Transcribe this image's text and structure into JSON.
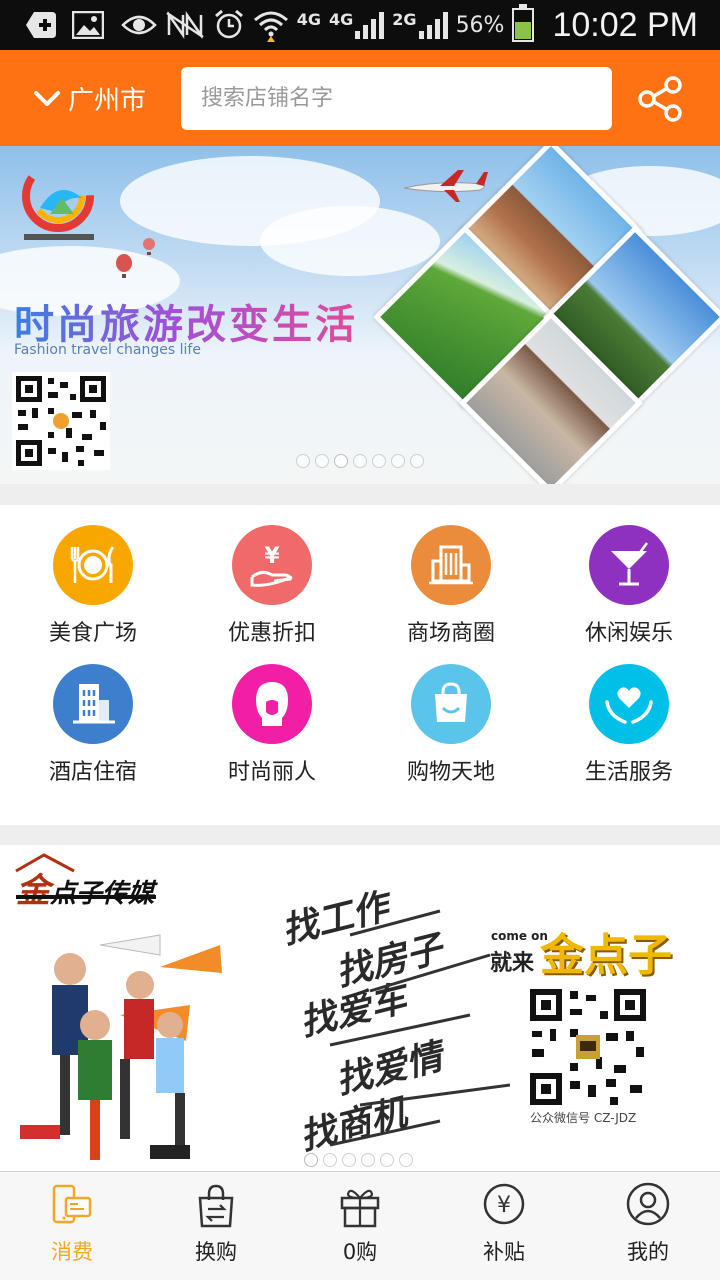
{
  "status_bar": {
    "net1": "4G",
    "net2": "4G",
    "net3": "2G",
    "battery_pct": "56%",
    "battery_level": 0.56,
    "time": "10:02 PM"
  },
  "header": {
    "city": "广州市",
    "search_placeholder": "搜索店铺名字",
    "accent_color": "#ff7214"
  },
  "banner1": {
    "title": "时尚旅游改变生活",
    "subtitle": "Fashion travel changes life",
    "dots_count": 7,
    "active_dot": 2
  },
  "categories": [
    {
      "label": "美食广场",
      "icon": "fork-plate-knife-icon",
      "color": "#f7a700"
    },
    {
      "label": "优惠折扣",
      "icon": "yen-hand-icon",
      "color": "#f06a6a"
    },
    {
      "label": "商场商圈",
      "icon": "mall-building-icon",
      "color": "#eb8b3c"
    },
    {
      "label": "休闲娱乐",
      "icon": "cocktail-icon",
      "color": "#8e30c0"
    },
    {
      "label": "酒店住宿",
      "icon": "hotel-building-icon",
      "color": "#3d7fcd"
    },
    {
      "label": "时尚丽人",
      "icon": "woman-head-icon",
      "color": "#f01fa5"
    },
    {
      "label": "购物天地",
      "icon": "shopping-bag-icon",
      "color": "#5ac4ea"
    },
    {
      "label": "生活服务",
      "icon": "heart-hands-icon",
      "color": "#00c0e8"
    }
  ],
  "banner2": {
    "logo_gold": "金",
    "logo_rest": "点子传媒",
    "slogans": [
      "找工作",
      "找房子",
      "找爱车",
      "找爱情",
      "找商机"
    ],
    "come_on": "come on",
    "jiulai": "就来",
    "brand": "金点子",
    "wechat": "公众微信号  CZ-JDZ",
    "dots_count": 6,
    "active_dot": 0
  },
  "tabbar": [
    {
      "label": "消费",
      "icon": "phone-card-icon",
      "active": true
    },
    {
      "label": "换购",
      "icon": "exchange-bag-icon",
      "active": false
    },
    {
      "label": "0购",
      "icon": "gift-box-icon",
      "active": false
    },
    {
      "label": "补贴",
      "icon": "yen-circle-icon",
      "active": false
    },
    {
      "label": "我的",
      "icon": "user-profile-icon",
      "active": false
    }
  ]
}
